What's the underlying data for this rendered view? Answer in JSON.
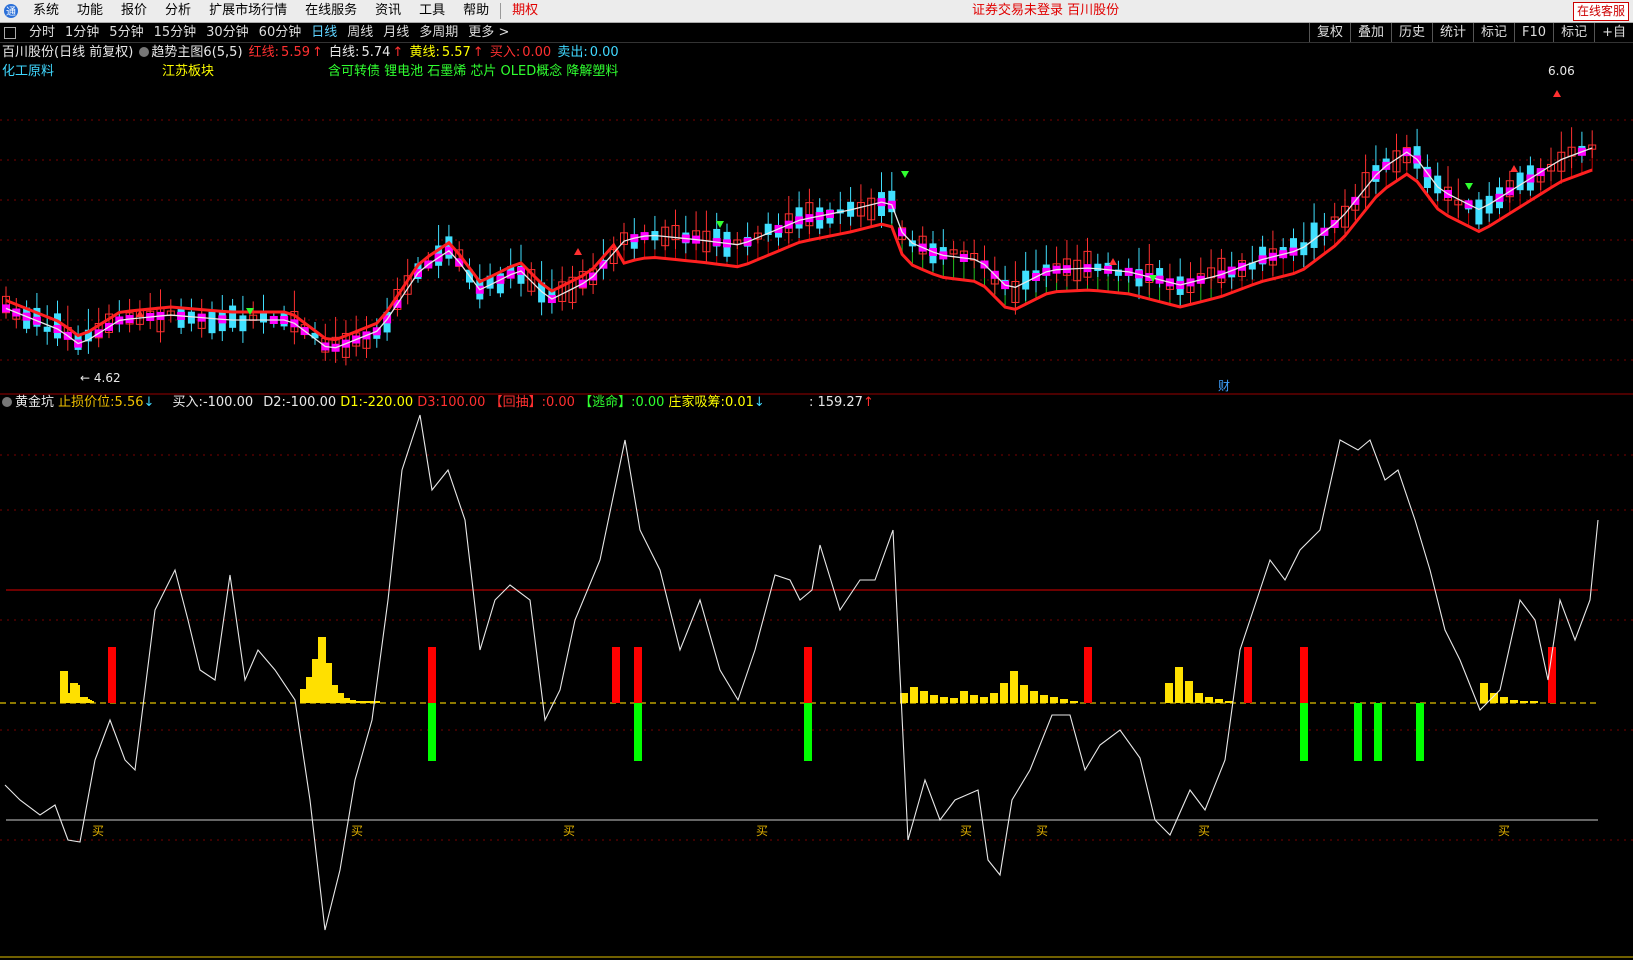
{
  "menu": {
    "items": [
      "系统",
      "功能",
      "报价",
      "分析",
      "扩展市场行情",
      "在线服务",
      "资讯",
      "工具",
      "帮助"
    ],
    "highlight": "期权",
    "notice": "证券交易未登录  百川股份",
    "service": "在线客服"
  },
  "periods": {
    "items": [
      "分时",
      "1分钟",
      "5分钟",
      "15分钟",
      "30分钟",
      "60分钟",
      "日线",
      "周线",
      "月线",
      "多周期",
      "更多"
    ],
    "active": "日线"
  },
  "toolbar": {
    "items": [
      "复权",
      "叠加",
      "历史",
      "统计",
      "标记",
      "F10",
      "标记",
      "+自"
    ]
  },
  "main": {
    "stock_title": "百川股份(日线 前复权)",
    "indicator": "趋势主图6(5,5)",
    "red_label": "红线:",
    "red_value": "5.59",
    "white_label": "白线:",
    "white_value": "5.74",
    "yellow_label": "黄线:",
    "yellow_value": "5.57",
    "buy_label": "买入:",
    "buy_value": "0.00",
    "sell_label": "卖出:",
    "sell_value": "0.00",
    "sector_left": "化工原料",
    "sector_mid": "江苏板块",
    "concepts": "含可转债 锂电池 石墨烯 芯片 OLED概念 降解塑料",
    "high_label": "6.06",
    "low_label": "4.62",
    "cai_label": "财"
  },
  "sub": {
    "name": "黄金坑",
    "stop_label": "止损价位:",
    "stop_value": "5.56",
    "buy_label": "买入:",
    "buy_value": "-100.00",
    "d2_label": "D2:",
    "d2_value": "-100.00",
    "d1_label": "D1:",
    "d1_value": "-220.00",
    "d3_label": "D3:",
    "d3_value": "100.00",
    "huitiao_label": "【回抽】:",
    "huitiao_value": "0.00",
    "taoming_label": "【逃命】:",
    "taoming_value": "0.00",
    "zj_label": "庄家吸筹:",
    "zj_value": "0.01",
    "extra_value": ": 159.27",
    "buy_marks": [
      "买",
      "买",
      "买",
      "买",
      "买",
      "买",
      "买",
      "买"
    ]
  },
  "colors": {
    "bg": "#000000",
    "up": "#ff3030",
    "down": "#40e0ff",
    "ma": "#ff00ff",
    "line": "#e8e8e8",
    "bar_yellow": "#ffe000",
    "bar_red": "#ff0000",
    "bar_green": "#00ff00",
    "grid": "#7a0000"
  }
}
